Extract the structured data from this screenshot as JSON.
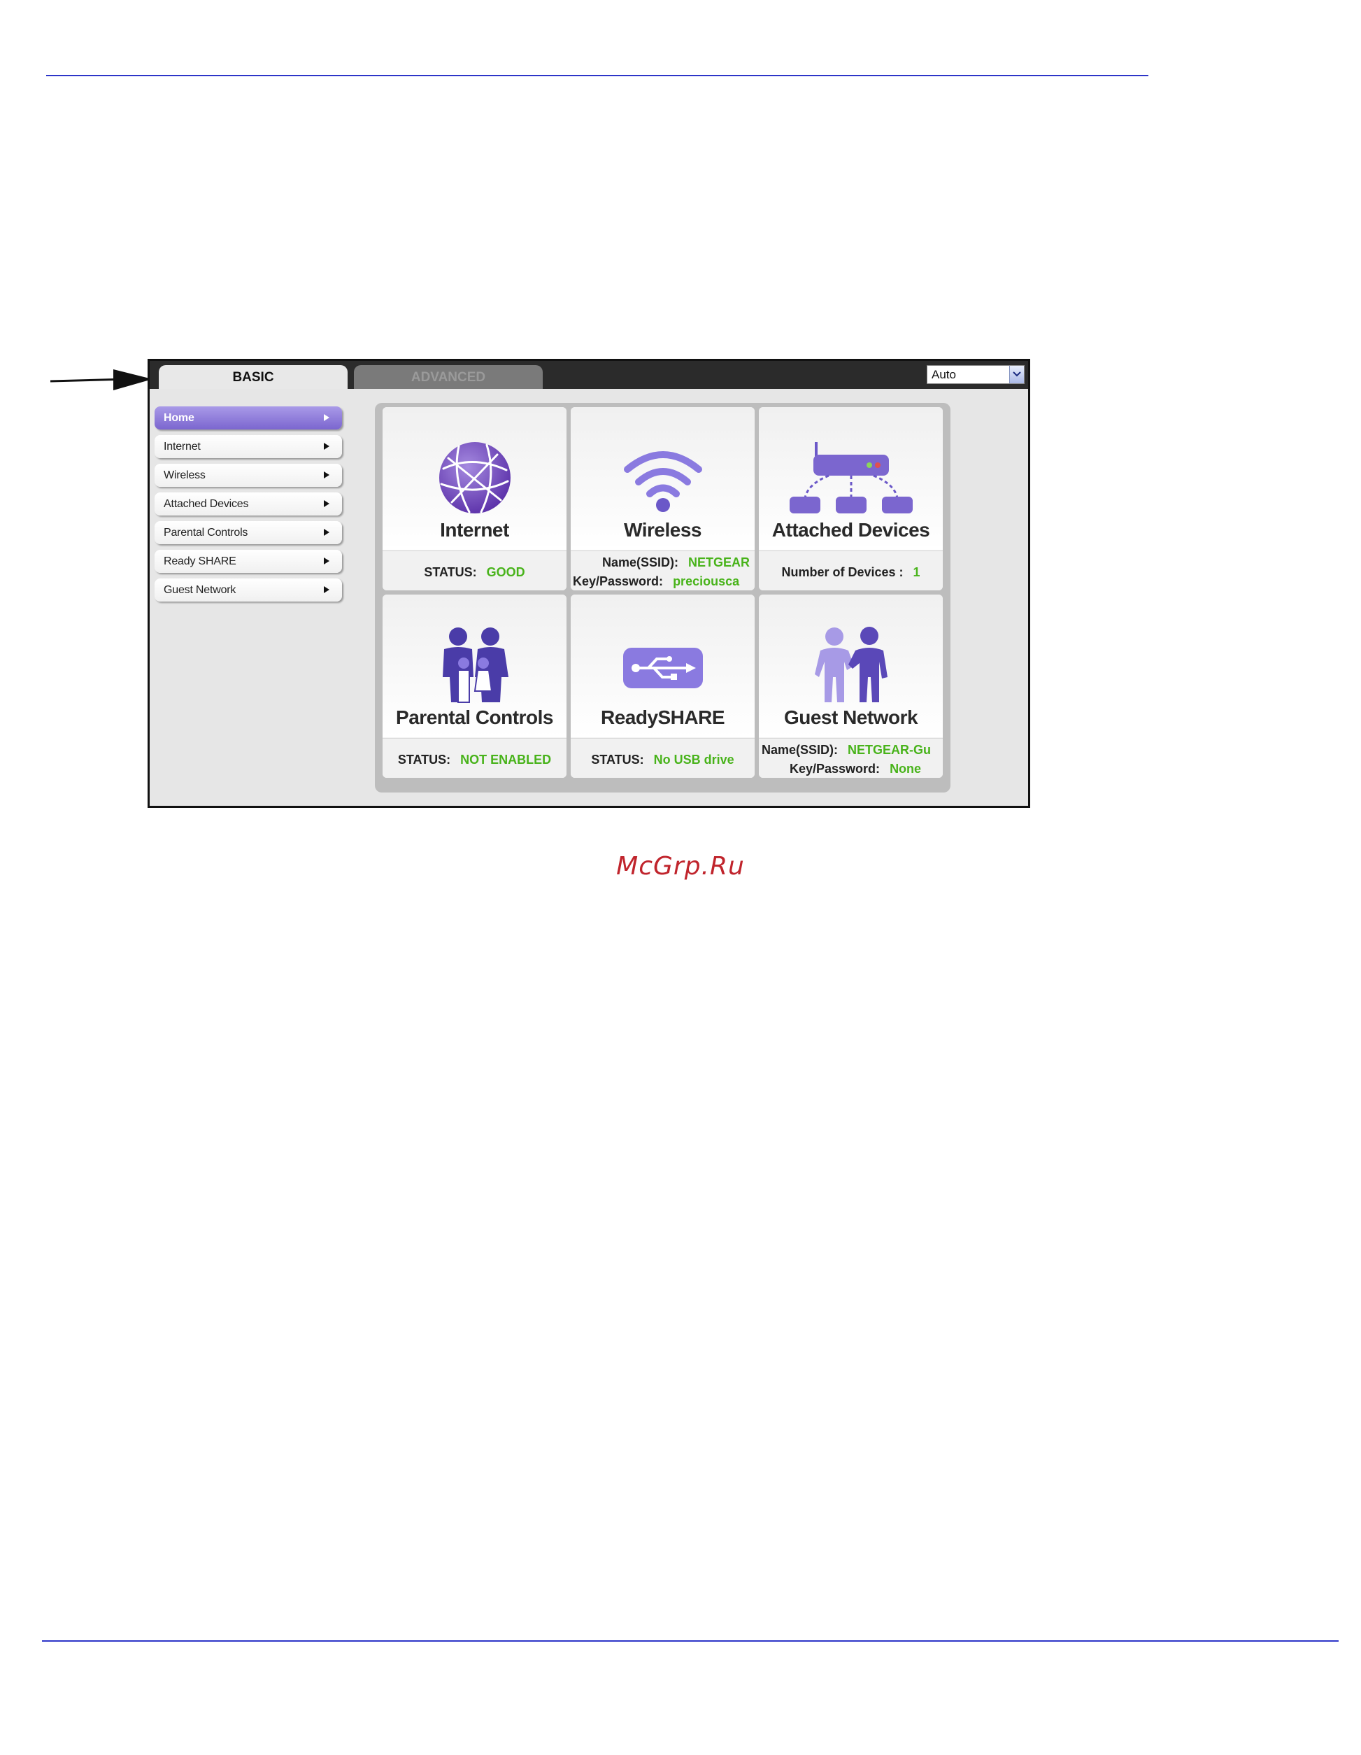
{
  "tabs": {
    "basic": "BASIC",
    "advanced": "ADVANCED"
  },
  "language_select": {
    "value": "Auto"
  },
  "sidebar": {
    "items": [
      {
        "label": "Home"
      },
      {
        "label": "Internet"
      },
      {
        "label": "Wireless"
      },
      {
        "label": "Attached Devices"
      },
      {
        "label": "Parental Controls"
      },
      {
        "label": "Ready SHARE"
      },
      {
        "label": "Guest Network"
      }
    ]
  },
  "cards": {
    "internet": {
      "title": "Internet",
      "status_label": "STATUS:",
      "status_value": "GOOD"
    },
    "wireless": {
      "title": "Wireless",
      "ssid_label": "Name(SSID):",
      "ssid_value": "NETGEAR",
      "key_label": "Key/Password:",
      "key_value": "preciousca"
    },
    "attached_devices": {
      "title": "Attached Devices",
      "count_label": "Number of Devices :",
      "count_value": "1"
    },
    "parental_controls": {
      "title": "Parental Controls",
      "status_label": "STATUS:",
      "status_value": "NOT ENABLED"
    },
    "readyshare": {
      "title": "ReadySHARE",
      "status_label": "STATUS:",
      "status_value": "No USB drive"
    },
    "guest_network": {
      "title": "Guest Network",
      "ssid_label": "Name(SSID):",
      "ssid_value": "NETGEAR-Gu",
      "key_label": "Key/Password:",
      "key_value": "None"
    }
  },
  "watermark": "McGrp.Ru",
  "colors": {
    "accent_purple": "#7b66cf",
    "status_green": "#48b31a",
    "rule_blue": "#2d35c8"
  }
}
